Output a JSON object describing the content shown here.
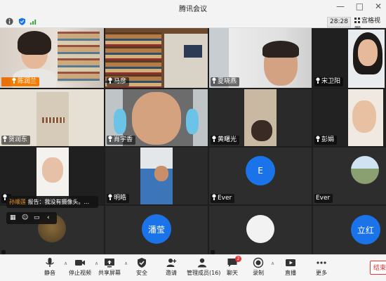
{
  "window": {
    "title": "腾讯会议",
    "buttons": [
      "—",
      "□",
      "✕"
    ]
  },
  "infobar": {
    "timer": "28:28",
    "view_label": "宫格视图"
  },
  "participants": [
    {
      "name": "陈润兰",
      "row": 0,
      "col": 0
    },
    {
      "name": "马彦",
      "row": 0,
      "col": 1
    },
    {
      "name": "夏晓燕",
      "row": 0,
      "col": 2
    },
    {
      "name": "宋卫阳",
      "row": 0,
      "col": 3
    },
    {
      "name": "贺润东",
      "row": 1,
      "col": 0
    },
    {
      "name": "肖宇香",
      "row": 1,
      "col": 1
    },
    {
      "name": "黄曙光",
      "row": 1,
      "col": 2
    },
    {
      "name": "彭娟",
      "row": 1,
      "col": 3
    },
    {
      "name": "",
      "row": 2,
      "col": 0
    },
    {
      "name": "明皓",
      "row": 2,
      "col": 1
    },
    {
      "name": "Ever",
      "row": 2,
      "col": 2,
      "avatar_letter": "E"
    },
    {
      "name": "Ever",
      "row": 2,
      "col": 3
    },
    {
      "name": "",
      "row": 3,
      "col": 0
    },
    {
      "name": "潘莹",
      "row": 3,
      "col": 1,
      "avatar_letter": "潘莹"
    },
    {
      "name": "",
      "row": 3,
      "col": 2
    },
    {
      "name": "立红",
      "row": 3,
      "col": 3,
      "avatar_letter": "立红"
    }
  ],
  "chat": {
    "sender": "孙顺莲",
    "message": "报告：我没有摄像头。..."
  },
  "toolbar": {
    "items": [
      {
        "label": "静音",
        "icon": "microphone-icon"
      },
      {
        "label": "停止视频",
        "icon": "camera-icon"
      },
      {
        "label": "共享屏幕",
        "icon": "share-screen-icon"
      },
      {
        "label": "安全",
        "icon": "shield-icon"
      },
      {
        "label": "邀请",
        "icon": "invite-icon"
      },
      {
        "label": "管理成员(16)",
        "icon": "members-icon"
      },
      {
        "label": "聊天",
        "icon": "chat-icon",
        "badge": "2"
      },
      {
        "label": "录制",
        "icon": "record-icon"
      },
      {
        "label": "直播",
        "icon": "live-icon"
      },
      {
        "label": "更多",
        "icon": "more-icon"
      }
    ],
    "end_label": "结束"
  },
  "colors": {
    "accent": "#1a73e8",
    "end": "#e33333",
    "background": "#1e1e1e"
  }
}
